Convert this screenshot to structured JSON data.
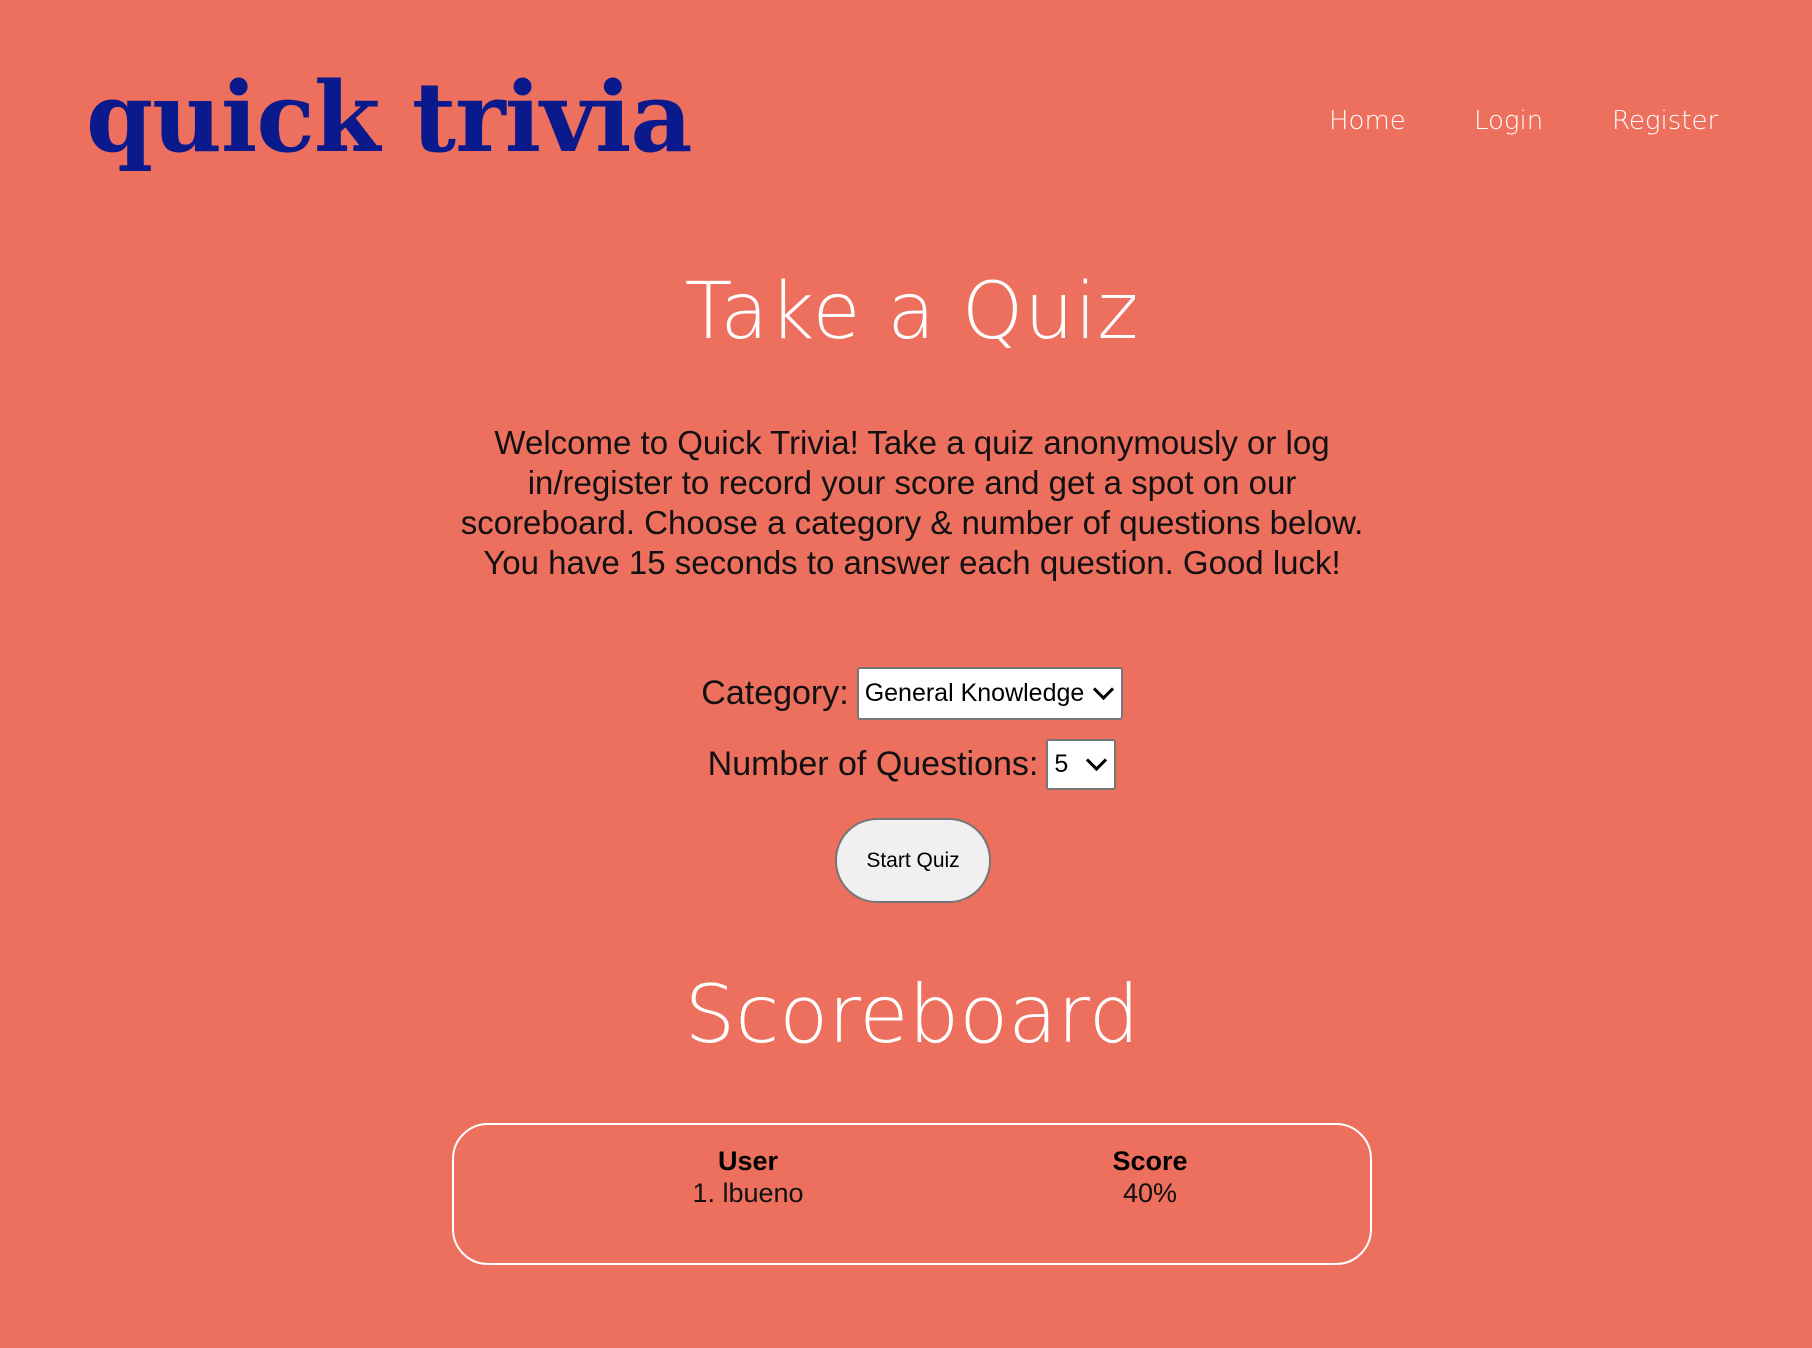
{
  "header": {
    "logo_text": "quick trivia",
    "logo_color": "#0A1A8C",
    "nav": {
      "home": "Home",
      "login": "Login",
      "register": "Register"
    }
  },
  "quiz": {
    "title": "Take a Quiz",
    "intro": "Welcome to Quick Trivia! Take a quiz anonymously or log in/register to record your score and get a spot on our scoreboard. Choose a category & number of questions below. You have 15 seconds to answer each question. Good luck!",
    "category_label": "Category:",
    "category_selected": "General Knowledge",
    "count_label": "Number of Questions:",
    "count_selected": "5",
    "start_label": "Start Quiz"
  },
  "scoreboard": {
    "title": "Scoreboard",
    "user_header": "User",
    "score_header": "Score",
    "rows": [
      {
        "user": "1. lbueno",
        "score": "40%"
      }
    ]
  },
  "colors": {
    "background": "#ED6F5E",
    "text_light": "#FFFFFF",
    "text_dark": "#111111"
  }
}
